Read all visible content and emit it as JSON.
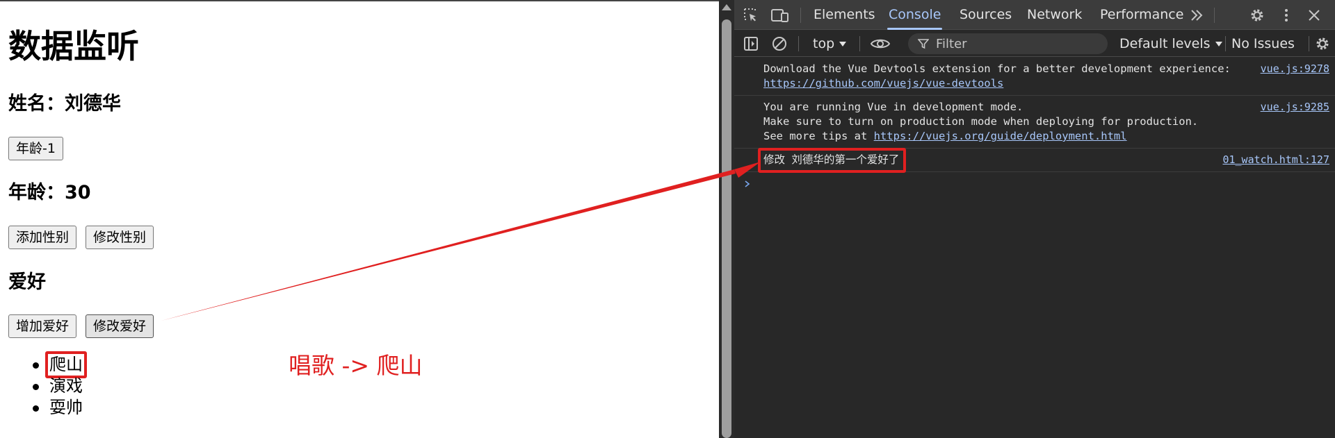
{
  "page": {
    "title": "数据监听",
    "name_heading": "姓名：刘德华",
    "age_minus_button": "年龄-1",
    "age_heading": "年龄：30",
    "add_gender_button": "添加性别",
    "change_gender_button": "修改性别",
    "hobby_heading": "爱好",
    "add_hobby_button": "增加爱好",
    "change_hobby_button": "修改爱好",
    "hobbies": [
      "爬山",
      "演戏",
      "耍帅"
    ],
    "annotation": "唱歌 -> 爬山"
  },
  "devtools": {
    "tabs": [
      "Elements",
      "Console",
      "Sources",
      "Network",
      "Performance"
    ],
    "active_tab": "Console",
    "more_tabs_icon": "double-chevron-right-icon",
    "toolbar": {
      "context": "top",
      "filter_placeholder": "Filter",
      "levels": "Default levels",
      "issues": "No Issues"
    },
    "messages": [
      {
        "lines": [
          "Download the Vue Devtools extension for a better development experience:"
        ],
        "link": "https://github.com/vuejs/vue-devtools",
        "source": "vue.js:9278"
      },
      {
        "lines": [
          "You are running Vue in development mode.",
          "Make sure to turn on production mode when deploying for production."
        ],
        "link_prefix": "See more tips at ",
        "link": "https://vuejs.org/guide/deployment.html",
        "source": "vue.js:9285"
      },
      {
        "lines": [
          "修改 刘德华的第一个爱好了"
        ],
        "source": "01_watch.html:127"
      }
    ]
  },
  "colors": {
    "annotation_red": "#e02020",
    "devtools_bg": "#282828",
    "accent_blue": "#a8c7fa"
  }
}
